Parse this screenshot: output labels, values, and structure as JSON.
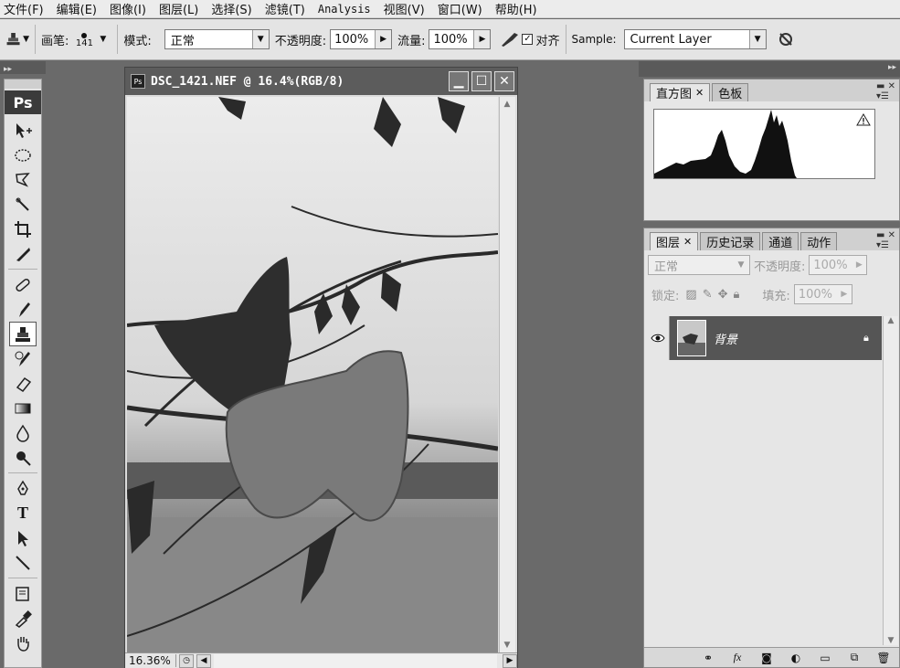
{
  "menu": [
    {
      "label": "文件(F)"
    },
    {
      "label": "编辑(E)"
    },
    {
      "label": "图像(I)"
    },
    {
      "label": "图层(L)"
    },
    {
      "label": "选择(S)"
    },
    {
      "label": "滤镜(T)"
    },
    {
      "label": "Analysis"
    },
    {
      "label": "视图(V)"
    },
    {
      "label": "窗口(W)"
    },
    {
      "label": "帮助(H)"
    }
  ],
  "options": {
    "brush_label": "画笔:",
    "brush_size": "141",
    "mode_label": "模式:",
    "mode_value": "正常",
    "opacity_label": "不透明度:",
    "opacity_value": "100%",
    "flow_label": "流量:",
    "flow_value": "100%",
    "aligned_label": "对齐",
    "sample_label": "Sample:",
    "sample_value": "Current Layer"
  },
  "toolbox": {
    "logo": "Ps",
    "tools": [
      "move-tool-icon",
      "marquee-tool-icon",
      "lasso-tool-icon",
      "magic-wand-tool-icon",
      "crop-tool-icon",
      "slice-tool-icon",
      "healing-brush-tool-icon",
      "brush-tool-icon",
      "clone-stamp-tool-icon",
      "history-brush-tool-icon",
      "eraser-tool-icon",
      "gradient-tool-icon",
      "blur-tool-icon",
      "dodge-tool-icon",
      "pen-tool-icon",
      "type-tool-icon",
      "path-selection-tool-icon",
      "line-tool-icon",
      "notes-tool-icon",
      "eyedropper-tool-icon",
      "hand-tool-icon"
    ]
  },
  "document": {
    "title": "DSC_1421.NEF @ 16.4%(RGB/8)",
    "zoom": "16.36%"
  },
  "histogram_panel": {
    "tabs": [
      "直方图",
      "色板"
    ]
  },
  "layers_panel": {
    "tabs": [
      "图层",
      "历史记录",
      "通道",
      "动作"
    ],
    "blend_mode": "正常",
    "opacity_label": "不透明度:",
    "opacity_value": "100%",
    "lock_label": "锁定:",
    "fill_label": "填充:",
    "fill_value": "100%",
    "layers": [
      {
        "name": "背景",
        "locked": true,
        "visible": true
      }
    ]
  },
  "colors": {
    "desktop": "#6a6a6a",
    "panel": "#e6e6e6",
    "selected_layer": "#555555"
  }
}
